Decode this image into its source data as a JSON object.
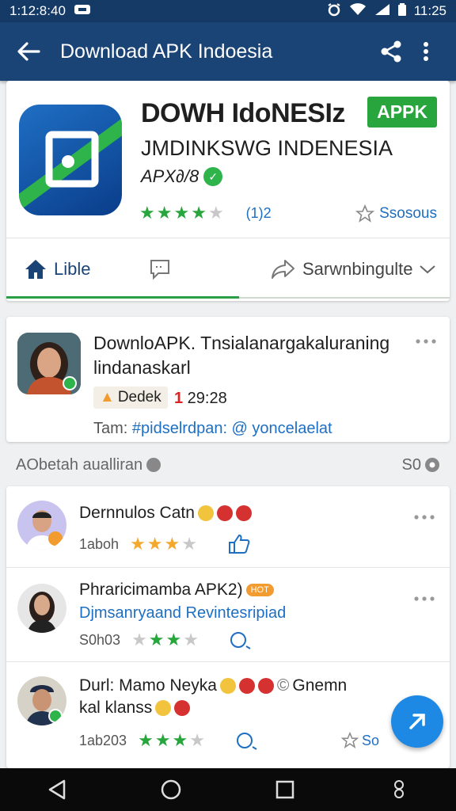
{
  "status_bar": {
    "time_left": "1:12:8:40",
    "time_right": "11:25"
  },
  "app_bar": {
    "title": "Download APK Indoesia"
  },
  "app": {
    "name": "DOWH IdoNESIz",
    "badge": "APPK",
    "developer": "JMDINKSWG INDENESIA",
    "version": "APX∂/8",
    "rating": 4,
    "rating_max": 5,
    "review_count": "(1)2",
    "save_label": "Ssosous"
  },
  "tabs": {
    "like": "Lible",
    "share": "Sarwnbingulte"
  },
  "post": {
    "title": "DownloAPK. Tnsialanargakaluraning lindanaskarl",
    "chip": "Dedek",
    "count_prefix": "1",
    "count_rest": " 29:28",
    "tags_label": "Tam:",
    "tags": "#pidselrdpan: @ yoncelaelat"
  },
  "section": {
    "title": "AObetah aualliran",
    "count": "S0"
  },
  "comments": [
    {
      "name": "Dernnulos Catn",
      "subtitle": "",
      "time": "1aboh",
      "stars": 3,
      "stars_max": 4
    },
    {
      "name": "Phraricimamba APK2)",
      "badge": "HOT",
      "subtitle": "Djmsanryaand  Revintesripiad",
      "time": "S0h03",
      "stars": 3,
      "stars_max": 4
    },
    {
      "name": "Durl: Mamo Neyka",
      "name_extra": "Gnemn",
      "subtitle2": "kal klanss",
      "time": "1ab203",
      "stars": 3,
      "stars_max": 4,
      "save_label": "So"
    }
  ],
  "colors": {
    "primary": "#1b4476",
    "accent": "#29a53d",
    "link": "#1e6fc2",
    "fab": "#1e88e5"
  }
}
